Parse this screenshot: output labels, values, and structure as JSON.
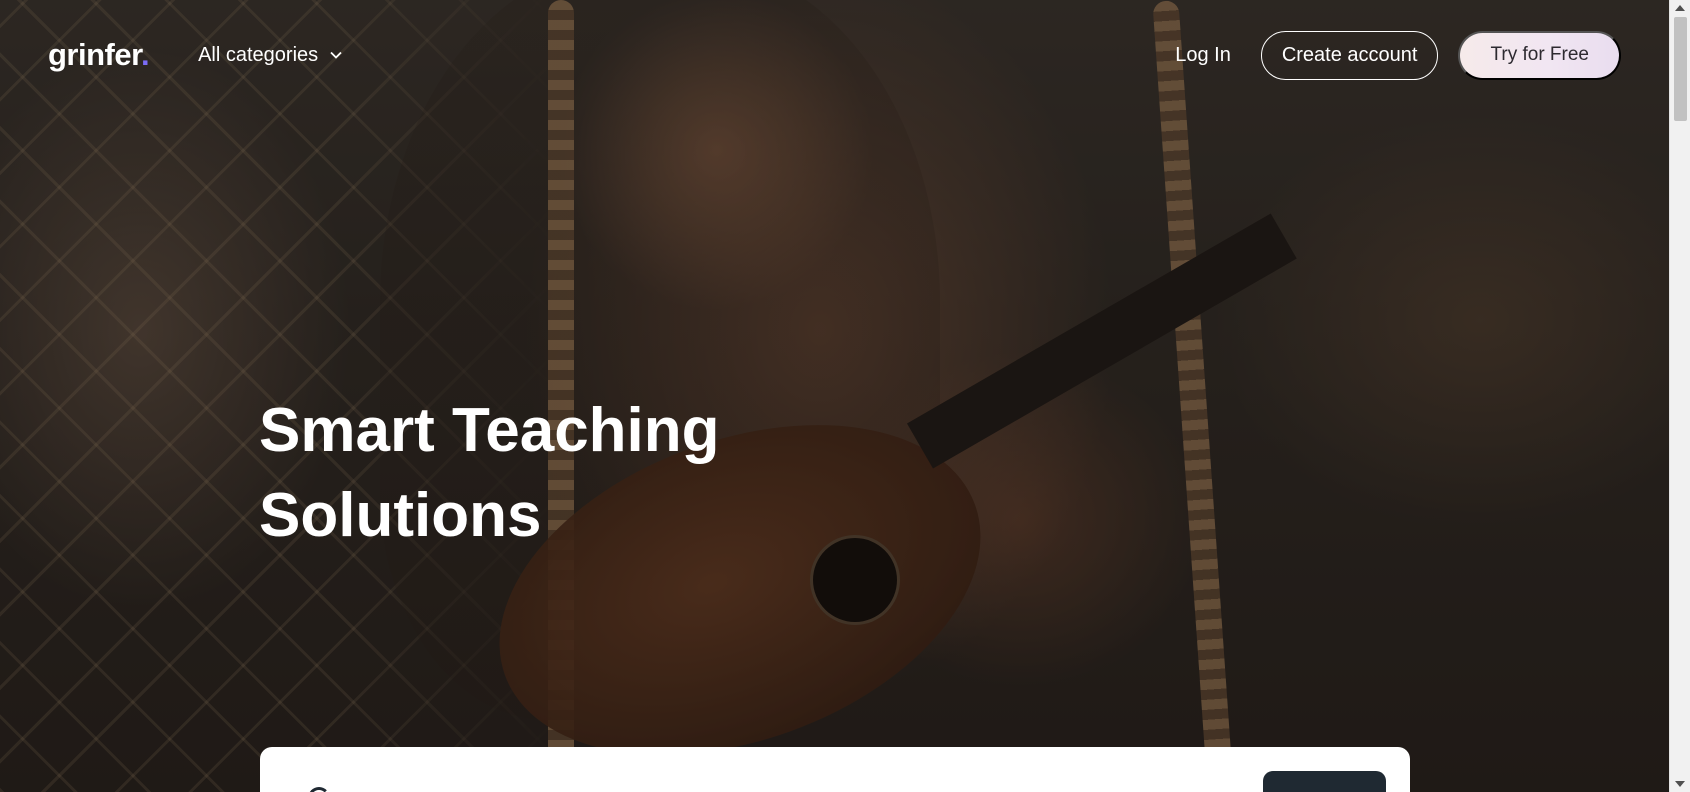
{
  "brand": {
    "name": "grinfer",
    "dot": ".",
    "dot_color": "#7b6cf6"
  },
  "nav": {
    "categories_label": "All categories",
    "categories_icon": "chevron-down-icon",
    "login_label": "Log In",
    "create_account_label": "Create account",
    "try_label": "Try for Free"
  },
  "hero": {
    "headline_line1": "Smart Teaching",
    "headline_line2": "Solutions",
    "background": "photo-woman-playing-ukulele"
  },
  "colors": {
    "text_on_hero": "#ffffff",
    "try_button_bg": "#f3e8ef",
    "search_button_bg": "#1f2932"
  }
}
